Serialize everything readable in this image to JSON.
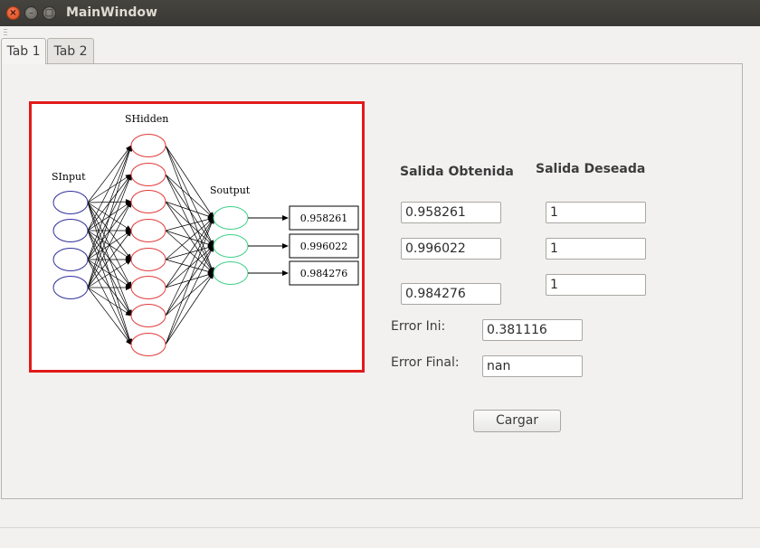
{
  "window": {
    "title": "MainWindow",
    "close_glyph": "×",
    "minimize_glyph": "–",
    "maximize_glyph": "□"
  },
  "tabs": [
    {
      "label": "Tab 1",
      "active": true
    },
    {
      "label": "Tab 2",
      "active": false
    }
  ],
  "network_image": {
    "input_label": "SInput",
    "hidden_label": "SHidden",
    "output_label": "Soutput",
    "output_values": [
      "0.958261",
      "0.996022",
      "0.984276"
    ],
    "input_count": 4,
    "hidden_count": 8,
    "output_count": 3,
    "colors": {
      "input": "#2f2f9a",
      "hidden": "#e23a3a",
      "output": "#3fcf8a",
      "frame": "#e21a1a"
    }
  },
  "form": {
    "salida_obtenida_header": "Salida Obtenida",
    "salida_deseada_header": "Salida Deseada",
    "obtenida_values": [
      "0.958261",
      "0.996022",
      "0.984276"
    ],
    "deseada_values": [
      "1",
      "1",
      "1"
    ],
    "error_ini_label": "Error Ini:",
    "error_ini_value": "0.381116",
    "error_final_label": "Error Final:",
    "error_final_value": "nan",
    "cargar_label": "Cargar"
  }
}
